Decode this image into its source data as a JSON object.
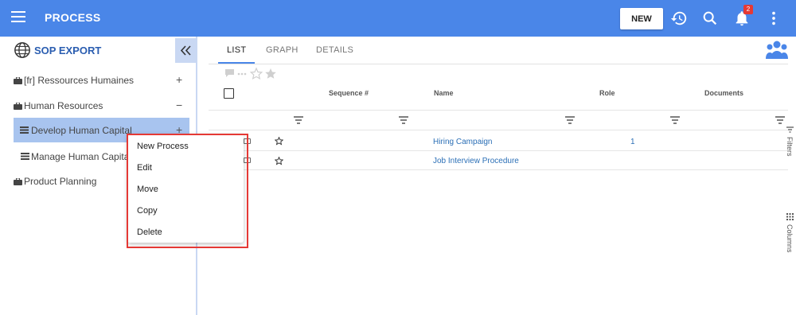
{
  "header": {
    "title": "PROCESS",
    "new_label": "NEW",
    "notification_count": "2"
  },
  "sidebar": {
    "title": "SOP EXPORT",
    "items": [
      {
        "label": "[fr] Ressources Humaines",
        "sign": "+"
      },
      {
        "label": "Human Resources",
        "sign": "−"
      },
      {
        "label": "Develop Human Capital",
        "sign": "+"
      },
      {
        "label": "Manage Human Capital",
        "sign": ""
      },
      {
        "label": "Product Planning",
        "sign": ""
      }
    ]
  },
  "tabs": [
    "LIST",
    "GRAPH",
    "DETAILS"
  ],
  "table": {
    "columns": [
      "Sequence #",
      "Name",
      "Role",
      "Documents"
    ],
    "rows": [
      {
        "name": "Hiring Campaign",
        "role": "1"
      },
      {
        "name": "Job Interview Procedure",
        "role": ""
      }
    ]
  },
  "side_panels": [
    "Filters",
    "Columns"
  ],
  "context_menu": [
    "New Process",
    "Edit",
    "Move",
    "Copy",
    "Delete"
  ],
  "colors": {
    "brand": "#4a86e8",
    "selected": "#a8c4ef",
    "highlight": "#e53935",
    "link": "#2b6fb6"
  }
}
